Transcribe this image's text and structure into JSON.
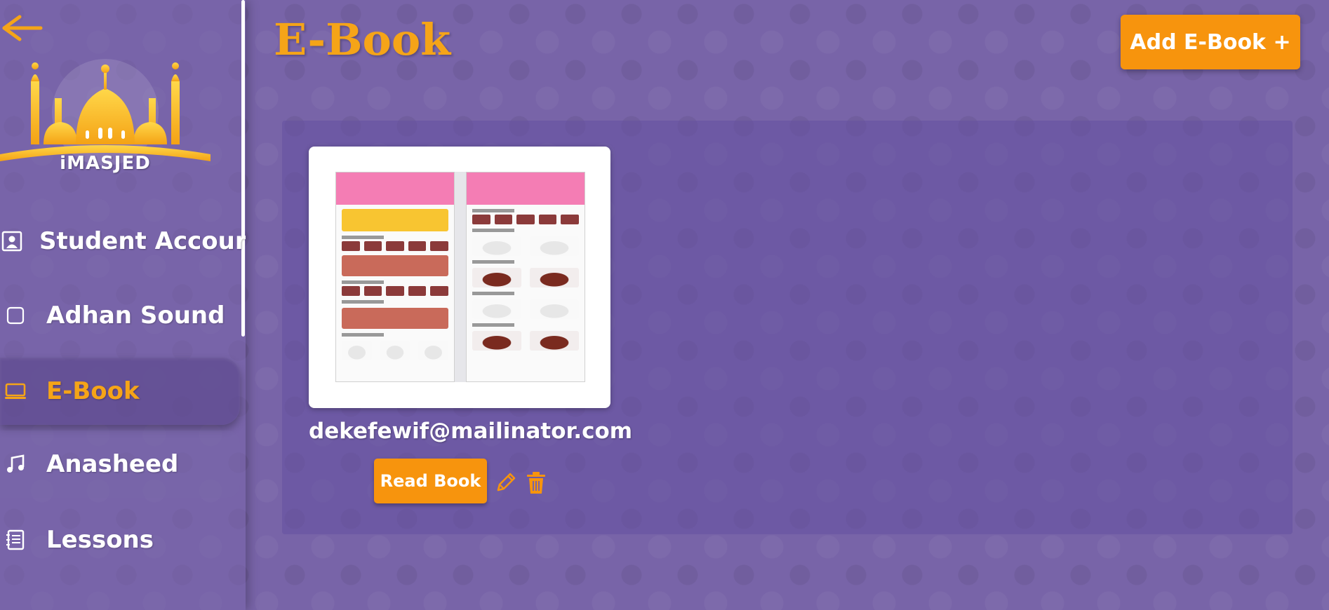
{
  "sidebar": {
    "logo_text": "iMASJED",
    "items": [
      {
        "label": "Student Account",
        "icon": "contact-card-icon"
      },
      {
        "label": "Adhan Sound",
        "icon": "square-icon"
      },
      {
        "label": "E-Book",
        "icon": "laptop-icon",
        "active": true
      },
      {
        "label": "Anasheed",
        "icon": "music-note-icon"
      },
      {
        "label": "Lessons",
        "icon": "notebook-icon"
      }
    ]
  },
  "header": {
    "title": "E-Book",
    "add_button_label": "Add E-Book +"
  },
  "books": [
    {
      "title": "dekefewif@mailinator.com",
      "read_button_label": "Read Book"
    }
  ],
  "colors": {
    "accent": "#f7940d",
    "title": "#f5a418",
    "background": "#7864a8"
  }
}
